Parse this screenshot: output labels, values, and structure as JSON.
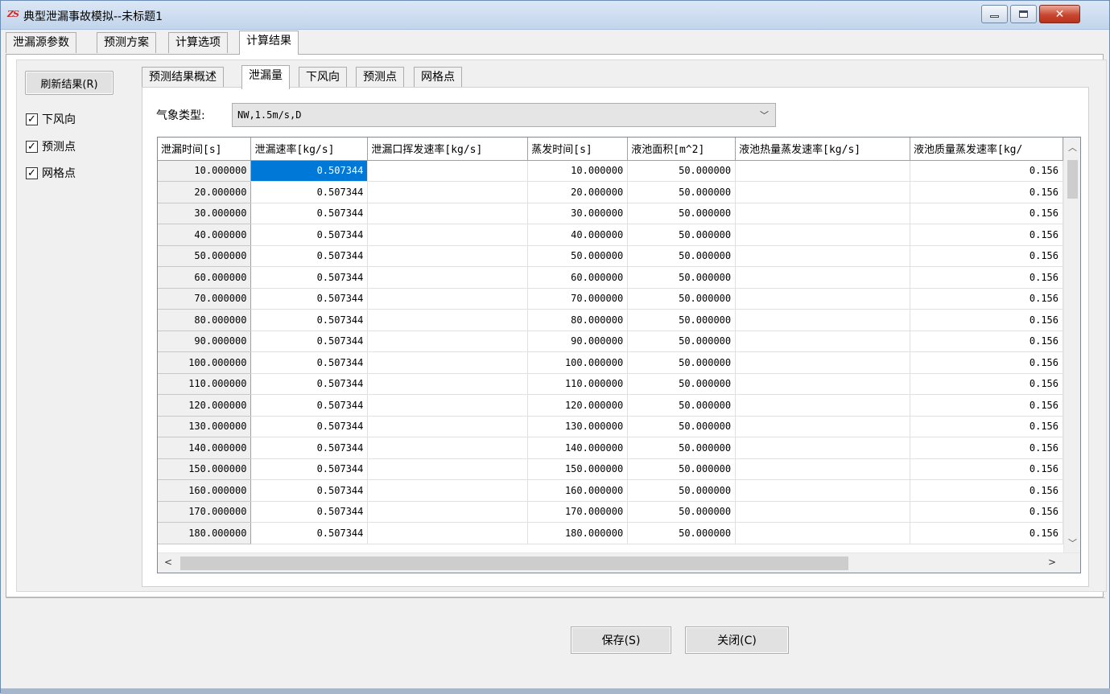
{
  "window": {
    "logo_text": "ZS",
    "title": "典型泄漏事故模拟--未标题1",
    "close_glyph": "✕"
  },
  "main_tabs": [
    {
      "label": "泄漏源参数"
    },
    {
      "label": "预测方案"
    },
    {
      "label": "计算选项"
    },
    {
      "label": "计算结果",
      "active": true
    }
  ],
  "sidebar": {
    "refresh_label": "刷新结果(R)",
    "checkboxes": [
      {
        "label": "下风向",
        "checked": true
      },
      {
        "label": "预测点",
        "checked": true
      },
      {
        "label": "网格点",
        "checked": true
      }
    ],
    "check_glyph": "✓"
  },
  "sub_tabs": [
    {
      "label": "预测结果概述"
    },
    {
      "label": "泄漏量",
      "active": true
    },
    {
      "label": "下风向"
    },
    {
      "label": "预测点"
    },
    {
      "label": "网格点"
    }
  ],
  "weather": {
    "label": "气象类型:",
    "value": "NW,1.5m/s,D",
    "chevron": "﹀"
  },
  "table": {
    "headers": [
      "泄漏时间[s]",
      "泄漏速率[kg/s]",
      "泄漏口挥发速率[kg/s]",
      "蒸发时间[s]",
      "液池面积[m^2]",
      "液池热量蒸发速率[kg/s]",
      "液池质量蒸发速率[kg/"
    ],
    "rows": [
      [
        "10.000000",
        "0.507344",
        "",
        "10.000000",
        "50.000000",
        "",
        "0.156"
      ],
      [
        "20.000000",
        "0.507344",
        "",
        "20.000000",
        "50.000000",
        "",
        "0.156"
      ],
      [
        "30.000000",
        "0.507344",
        "",
        "30.000000",
        "50.000000",
        "",
        "0.156"
      ],
      [
        "40.000000",
        "0.507344",
        "",
        "40.000000",
        "50.000000",
        "",
        "0.156"
      ],
      [
        "50.000000",
        "0.507344",
        "",
        "50.000000",
        "50.000000",
        "",
        "0.156"
      ],
      [
        "60.000000",
        "0.507344",
        "",
        "60.000000",
        "50.000000",
        "",
        "0.156"
      ],
      [
        "70.000000",
        "0.507344",
        "",
        "70.000000",
        "50.000000",
        "",
        "0.156"
      ],
      [
        "80.000000",
        "0.507344",
        "",
        "80.000000",
        "50.000000",
        "",
        "0.156"
      ],
      [
        "90.000000",
        "0.507344",
        "",
        "90.000000",
        "50.000000",
        "",
        "0.156"
      ],
      [
        "100.000000",
        "0.507344",
        "",
        "100.000000",
        "50.000000",
        "",
        "0.156"
      ],
      [
        "110.000000",
        "0.507344",
        "",
        "110.000000",
        "50.000000",
        "",
        "0.156"
      ],
      [
        "120.000000",
        "0.507344",
        "",
        "120.000000",
        "50.000000",
        "",
        "0.156"
      ],
      [
        "130.000000",
        "0.507344",
        "",
        "130.000000",
        "50.000000",
        "",
        "0.156"
      ],
      [
        "140.000000",
        "0.507344",
        "",
        "140.000000",
        "50.000000",
        "",
        "0.156"
      ],
      [
        "150.000000",
        "0.507344",
        "",
        "150.000000",
        "50.000000",
        "",
        "0.156"
      ],
      [
        "160.000000",
        "0.507344",
        "",
        "160.000000",
        "50.000000",
        "",
        "0.156"
      ],
      [
        "170.000000",
        "0.507344",
        "",
        "170.000000",
        "50.000000",
        "",
        "0.156"
      ],
      [
        "180.000000",
        "0.507344",
        "",
        "180.000000",
        "50.000000",
        "",
        "0.156"
      ]
    ],
    "selected_cell": {
      "row": 0,
      "col": 1
    },
    "scroll_glyphs": {
      "up": "︿",
      "down": "﹀",
      "left": "<",
      "right": ">"
    }
  },
  "footer": {
    "save_label": "保存(S)",
    "close_label": "关闭(C)"
  },
  "colors": {
    "selection": "#0078d7",
    "close_button": "#c94730",
    "logo": "#d9231e"
  }
}
